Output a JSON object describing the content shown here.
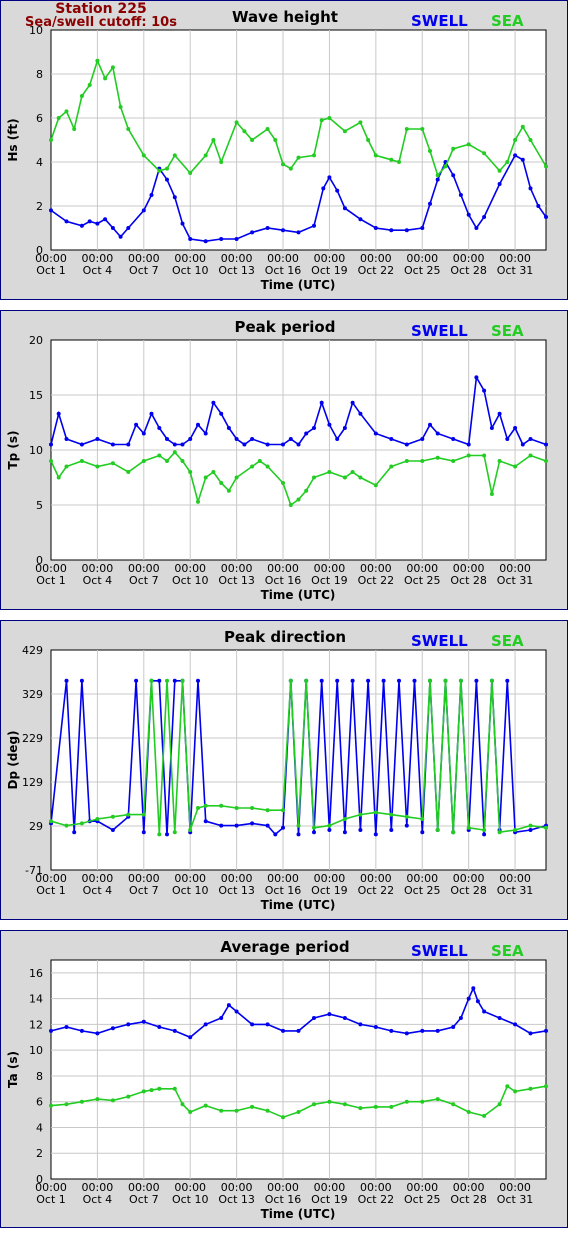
{
  "station": {
    "title": "Station 225",
    "cutoff": "Sea/swell cutoff: 10s"
  },
  "legend": {
    "swell_label": "SWELL",
    "sea_label": "SEA"
  },
  "colors": {
    "swell": "#0000ee",
    "sea": "#22cc22",
    "station": "#8b0000",
    "frame": "#000080",
    "panel_bg": "#d9d9d9"
  },
  "chart_data": [
    {
      "type": "line",
      "title": "Wave height",
      "xlabel": "Time (UTC)",
      "ylabel": "Hs (ft)",
      "ylim": [
        0,
        10
      ],
      "yticks": [
        "0",
        "2",
        "4",
        "6",
        "8",
        "10"
      ],
      "xlim_days": [
        1,
        33
      ],
      "xticks": [
        {
          "top": "00:00",
          "bottom": "Oct 1"
        },
        {
          "top": "00:00",
          "bottom": "Oct 4"
        },
        {
          "top": "00:00",
          "bottom": "Oct 7"
        },
        {
          "top": "00:00",
          "bottom": "Oct 10"
        },
        {
          "top": "00:00",
          "bottom": "Oct 13"
        },
        {
          "top": "00:00",
          "bottom": "Oct 16"
        },
        {
          "top": "00:00",
          "bottom": "Oct 19"
        },
        {
          "top": "00:00",
          "bottom": "Oct 22"
        },
        {
          "top": "00:00",
          "bottom": "Oct 25"
        },
        {
          "top": "00:00",
          "bottom": "Oct 28"
        },
        {
          "top": "00:00",
          "bottom": "Oct 31"
        }
      ],
      "grid": true,
      "series": [
        {
          "name": "SWELL",
          "color": "#0000ee",
          "x": [
            1,
            2,
            3,
            3.5,
            4,
            4.5,
            5,
            5.5,
            6,
            7,
            7.5,
            8,
            8.5,
            9,
            9.5,
            10,
            11,
            12,
            13,
            14,
            15,
            16,
            17,
            18,
            18.6,
            19,
            19.5,
            20,
            21,
            22,
            23,
            24,
            25,
            25.5,
            26,
            26.5,
            27,
            27.5,
            28,
            28.5,
            29,
            30,
            31,
            31.5,
            32,
            32.5,
            33
          ],
          "y": [
            1.8,
            1.3,
            1.1,
            1.3,
            1.2,
            1.4,
            1.0,
            0.6,
            1.0,
            1.8,
            2.5,
            3.7,
            3.2,
            2.4,
            1.2,
            0.5,
            0.4,
            0.5,
            0.5,
            0.8,
            1.0,
            0.9,
            0.8,
            1.1,
            2.8,
            3.3,
            2.7,
            1.9,
            1.4,
            1.0,
            0.9,
            0.9,
            1.0,
            2.1,
            3.2,
            4.0,
            3.4,
            2.5,
            1.6,
            1.0,
            1.5,
            3.0,
            4.3,
            4.1,
            2.8,
            2.0,
            1.5
          ]
        },
        {
          "name": "SEA",
          "color": "#22cc22",
          "x": [
            1,
            1.5,
            2,
            2.5,
            3,
            3.5,
            4,
            4.5,
            5,
            5.5,
            6,
            7,
            8,
            8.5,
            9,
            10,
            11,
            11.5,
            12,
            13,
            13.5,
            14,
            15,
            15.5,
            16,
            16.5,
            17,
            18,
            18.5,
            19,
            20,
            21,
            21.5,
            22,
            23,
            23.5,
            24,
            25,
            25.5,
            26,
            26.5,
            27,
            28,
            29,
            30,
            30.5,
            31,
            31.5,
            32,
            33
          ],
          "y": [
            5.0,
            6.0,
            6.3,
            5.5,
            7.0,
            7.5,
            8.6,
            7.8,
            8.3,
            6.5,
            5.5,
            4.3,
            3.6,
            3.7,
            4.3,
            3.5,
            4.3,
            5.0,
            4.0,
            5.8,
            5.4,
            5.0,
            5.5,
            5.0,
            3.9,
            3.7,
            4.2,
            4.3,
            5.9,
            6.0,
            5.4,
            5.8,
            5.0,
            4.3,
            4.1,
            4.0,
            5.5,
            5.5,
            4.5,
            3.4,
            3.8,
            4.6,
            4.8,
            4.4,
            3.6,
            4.0,
            5.0,
            5.6,
            5.0,
            3.8
          ]
        }
      ]
    },
    {
      "type": "line",
      "title": "Peak period",
      "xlabel": "Time (UTC)",
      "ylabel": "Tp (s)",
      "ylim": [
        0,
        20
      ],
      "yticks": [
        "0",
        "5",
        "10",
        "15",
        "20"
      ],
      "xlim_days": [
        1,
        33
      ],
      "xticks": [
        {
          "top": "00:00",
          "bottom": "Oct 1"
        },
        {
          "top": "00:00",
          "bottom": "Oct 4"
        },
        {
          "top": "00:00",
          "bottom": "Oct 7"
        },
        {
          "top": "00:00",
          "bottom": "Oct 10"
        },
        {
          "top": "00:00",
          "bottom": "Oct 13"
        },
        {
          "top": "00:00",
          "bottom": "Oct 16"
        },
        {
          "top": "00:00",
          "bottom": "Oct 19"
        },
        {
          "top": "00:00",
          "bottom": "Oct 22"
        },
        {
          "top": "00:00",
          "bottom": "Oct 25"
        },
        {
          "top": "00:00",
          "bottom": "Oct 28"
        },
        {
          "top": "00:00",
          "bottom": "Oct 31"
        }
      ],
      "grid": true,
      "series": [
        {
          "name": "SWELL",
          "color": "#0000ee",
          "x": [
            1,
            1.5,
            2,
            3,
            4,
            5,
            6,
            6.5,
            7,
            7.5,
            8,
            8.5,
            9,
            9.5,
            10,
            10.5,
            11,
            11.5,
            12,
            12.5,
            13,
            13.5,
            14,
            15,
            16,
            16.5,
            17,
            17.5,
            18,
            18.5,
            19,
            19.5,
            20,
            20.5,
            21,
            22,
            23,
            24,
            25,
            25.5,
            26,
            27,
            28,
            28.5,
            29,
            29.5,
            30,
            30.5,
            31,
            31.5,
            32,
            33
          ],
          "y": [
            10.5,
            13.3,
            11,
            10.5,
            11,
            10.5,
            10.5,
            12.3,
            11.5,
            13.3,
            12,
            11,
            10.5,
            10.5,
            11,
            12.3,
            11.5,
            14.3,
            13.3,
            12,
            11,
            10.5,
            11,
            10.5,
            10.5,
            11,
            10.5,
            11.5,
            12,
            14.3,
            12.3,
            11,
            12,
            14.3,
            13.3,
            11.5,
            11,
            10.5,
            11,
            12.3,
            11.5,
            11,
            10.5,
            16.6,
            15.4,
            12,
            13.3,
            11,
            12,
            10.5,
            11,
            10.5
          ]
        },
        {
          "name": "SEA",
          "color": "#22cc22",
          "x": [
            1,
            1.5,
            2,
            3,
            4,
            5,
            6,
            7,
            8,
            8.5,
            9,
            9.5,
            10,
            10.5,
            11,
            11.5,
            12,
            12.5,
            13,
            14,
            14.5,
            15,
            16,
            16.5,
            17,
            17.5,
            18,
            19,
            20,
            20.5,
            21,
            22,
            23,
            24,
            25,
            26,
            27,
            28,
            29,
            29.5,
            30,
            31,
            32,
            33
          ],
          "y": [
            9.0,
            7.5,
            8.5,
            9.0,
            8.5,
            8.8,
            8.0,
            9.0,
            9.5,
            9.0,
            9.8,
            9.0,
            8.0,
            5.3,
            7.5,
            8.0,
            7.0,
            6.3,
            7.5,
            8.5,
            9.0,
            8.5,
            7.0,
            5.0,
            5.5,
            6.3,
            7.5,
            8.0,
            7.5,
            8.0,
            7.5,
            6.8,
            8.5,
            9.0,
            9.0,
            9.3,
            9.0,
            9.5,
            9.5,
            6.0,
            9.0,
            8.5,
            9.5,
            9.0
          ]
        }
      ]
    },
    {
      "type": "line",
      "title": "Peak direction",
      "xlabel": "Time (UTC)",
      "ylabel": "Dp (deg)",
      "ylim": [
        -71,
        429
      ],
      "yticks": [
        "-71",
        "29",
        "129",
        "229",
        "329",
        "429"
      ],
      "xlim_days": [
        1,
        33
      ],
      "xticks": [
        {
          "top": "00:00",
          "bottom": "Oct 1"
        },
        {
          "top": "00:00",
          "bottom": "Oct 4"
        },
        {
          "top": "00:00",
          "bottom": "Oct 7"
        },
        {
          "top": "00:00",
          "bottom": "Oct 10"
        },
        {
          "top": "00:00",
          "bottom": "Oct 13"
        },
        {
          "top": "00:00",
          "bottom": "Oct 16"
        },
        {
          "top": "00:00",
          "bottom": "Oct 19"
        },
        {
          "top": "00:00",
          "bottom": "Oct 22"
        },
        {
          "top": "00:00",
          "bottom": "Oct 25"
        },
        {
          "top": "00:00",
          "bottom": "Oct 28"
        },
        {
          "top": "00:00",
          "bottom": "Oct 31"
        }
      ],
      "grid": true,
      "series": [
        {
          "name": "SWELL",
          "color": "#0000ee",
          "x": [
            1,
            2,
            2.5,
            3,
            3.5,
            4,
            5,
            6,
            6.5,
            7,
            7.5,
            8,
            8.5,
            9,
            9.5,
            10,
            10.5,
            11,
            12,
            13,
            14,
            15,
            15.5,
            16,
            16.5,
            17,
            17.5,
            18,
            18.5,
            19,
            19.5,
            20,
            20.5,
            21,
            21.5,
            22,
            22.5,
            23,
            23.5,
            24,
            24.5,
            25,
            25.5,
            26,
            26.5,
            27,
            27.5,
            28,
            28.5,
            29,
            29.5,
            30,
            30.5,
            31,
            32,
            33
          ],
          "y": [
            35,
            359,
            15,
            359,
            40,
            40,
            20,
            50,
            359,
            15,
            359,
            359,
            10,
            359,
            359,
            15,
            359,
            40,
            30,
            30,
            35,
            30,
            10,
            25,
            359,
            10,
            359,
            15,
            359,
            20,
            359,
            15,
            359,
            20,
            359,
            10,
            359,
            20,
            359,
            30,
            359,
            15,
            359,
            20,
            359,
            15,
            359,
            20,
            359,
            10,
            359,
            20,
            359,
            15,
            20,
            30
          ]
        },
        {
          "name": "SEA",
          "color": "#22cc22",
          "x": [
            1,
            2,
            3,
            4,
            5,
            6,
            7,
            7.5,
            8,
            8.5,
            9,
            9.5,
            10,
            10.5,
            11,
            12,
            13,
            14,
            15,
            16,
            16.5,
            17,
            17.5,
            18,
            19,
            20,
            21,
            22,
            23,
            24,
            25,
            25.5,
            26,
            26.5,
            27,
            27.5,
            28,
            29,
            29.5,
            30,
            31,
            32,
            33
          ],
          "y": [
            40,
            30,
            35,
            45,
            50,
            55,
            55,
            359,
            10,
            359,
            15,
            359,
            20,
            70,
            75,
            75,
            70,
            70,
            65,
            65,
            359,
            30,
            359,
            25,
            30,
            45,
            55,
            60,
            55,
            50,
            45,
            359,
            20,
            359,
            15,
            359,
            25,
            20,
            359,
            15,
            20,
            30,
            25
          ]
        }
      ]
    },
    {
      "type": "line",
      "title": "Average period",
      "xlabel": "Time (UTC)",
      "ylabel": "Ta (s)",
      "ylim": [
        0,
        17
      ],
      "yticks": [
        "0",
        "2",
        "4",
        "6",
        "8",
        "10",
        "12",
        "14",
        "16"
      ],
      "xlim_days": [
        1,
        33
      ],
      "xticks": [
        {
          "top": "00:00",
          "bottom": "Oct 1"
        },
        {
          "top": "00:00",
          "bottom": "Oct 4"
        },
        {
          "top": "00:00",
          "bottom": "Oct 7"
        },
        {
          "top": "00:00",
          "bottom": "Oct 10"
        },
        {
          "top": "00:00",
          "bottom": "Oct 13"
        },
        {
          "top": "00:00",
          "bottom": "Oct 16"
        },
        {
          "top": "00:00",
          "bottom": "Oct 19"
        },
        {
          "top": "00:00",
          "bottom": "Oct 22"
        },
        {
          "top": "00:00",
          "bottom": "Oct 25"
        },
        {
          "top": "00:00",
          "bottom": "Oct 28"
        },
        {
          "top": "00:00",
          "bottom": "Oct 31"
        }
      ],
      "grid": true,
      "series": [
        {
          "name": "SWELL",
          "color": "#0000ee",
          "x": [
            1,
            2,
            3,
            4,
            5,
            6,
            7,
            8,
            9,
            10,
            11,
            12,
            12.5,
            13,
            14,
            15,
            16,
            17,
            18,
            19,
            20,
            21,
            22,
            23,
            24,
            25,
            26,
            27,
            27.5,
            28,
            28.3,
            28.6,
            29,
            30,
            31,
            32,
            33
          ],
          "y": [
            11.5,
            11.8,
            11.5,
            11.3,
            11.7,
            12.0,
            12.2,
            11.8,
            11.5,
            11.0,
            12.0,
            12.5,
            13.5,
            13.0,
            12.0,
            12.0,
            11.5,
            11.5,
            12.5,
            12.8,
            12.5,
            12.0,
            11.8,
            11.5,
            11.3,
            11.5,
            11.5,
            11.8,
            12.5,
            14.0,
            14.8,
            13.8,
            13.0,
            12.5,
            12.0,
            11.3,
            11.5
          ]
        },
        {
          "name": "SEA",
          "color": "#22cc22",
          "x": [
            1,
            2,
            3,
            4,
            5,
            6,
            7,
            7.5,
            8,
            9,
            9.5,
            10,
            11,
            12,
            13,
            14,
            15,
            16,
            17,
            18,
            19,
            20,
            21,
            22,
            23,
            24,
            25,
            26,
            27,
            28,
            29,
            30,
            30.5,
            31,
            32,
            33
          ],
          "y": [
            5.7,
            5.8,
            6.0,
            6.2,
            6.1,
            6.4,
            6.8,
            6.9,
            7.0,
            7.0,
            5.8,
            5.2,
            5.7,
            5.3,
            5.3,
            5.6,
            5.3,
            4.8,
            5.2,
            5.8,
            6.0,
            5.8,
            5.5,
            5.6,
            5.6,
            6.0,
            6.0,
            6.2,
            5.8,
            5.2,
            4.9,
            5.8,
            7.2,
            6.8,
            7.0,
            7.2
          ]
        }
      ]
    }
  ]
}
